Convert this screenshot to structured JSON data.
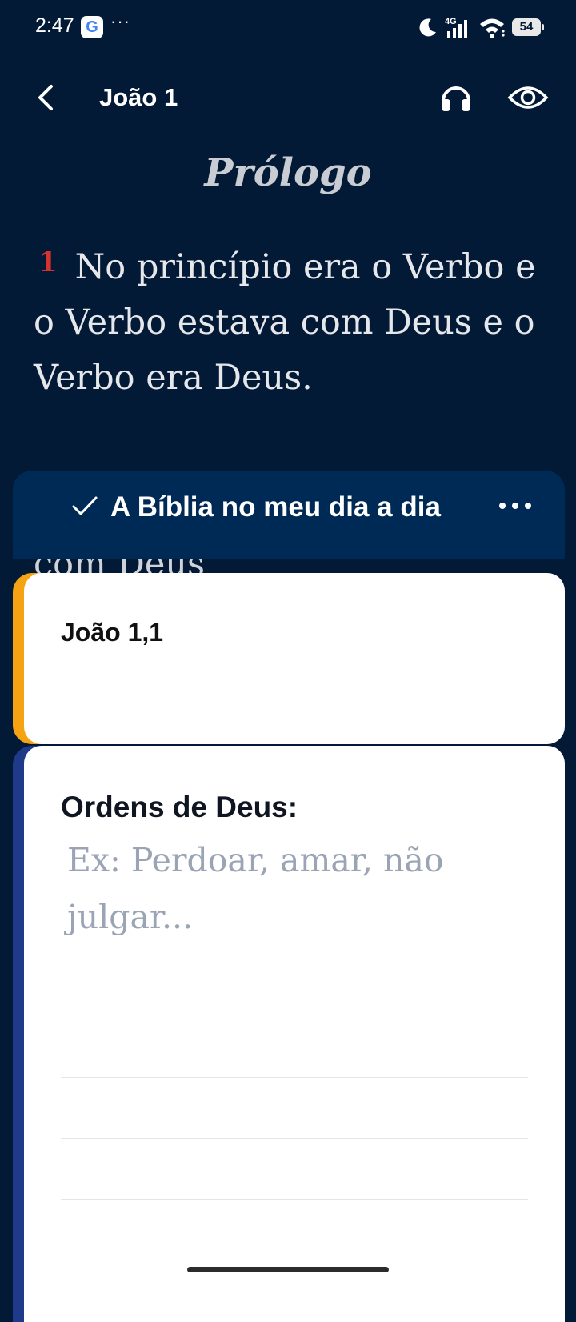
{
  "status_bar": {
    "time": "2:47",
    "google_badge": "G",
    "more_indicator": "···",
    "network": "4G",
    "battery": "54"
  },
  "app_bar": {
    "title": "João 1",
    "back_icon": "chevron-left-icon",
    "audio_icon": "headphones-icon",
    "view_icon": "eye-icon"
  },
  "reader": {
    "section_title": "Prólogo",
    "verse_number": "1",
    "verse_text": "No princípio era o Verbo e o Verbo estava com Deus e o Verbo era Deus.",
    "peek_text": "com Deus"
  },
  "banner": {
    "label": "A Bíblia no meu dia a dia",
    "check_icon": "check-icon",
    "more_icon": "more-horizontal-icon"
  },
  "reference_card": {
    "title": "João 1,1",
    "accent_color": "#f6a313"
  },
  "notes_card": {
    "title": "Ordens de Deus:",
    "placeholder": "Ex: Perdoar, amar, não julgar...",
    "accent_color": "#1f3a8a"
  },
  "colors": {
    "background": "#031a36",
    "banner": "#002a56",
    "verse_number": "#d5342e"
  }
}
